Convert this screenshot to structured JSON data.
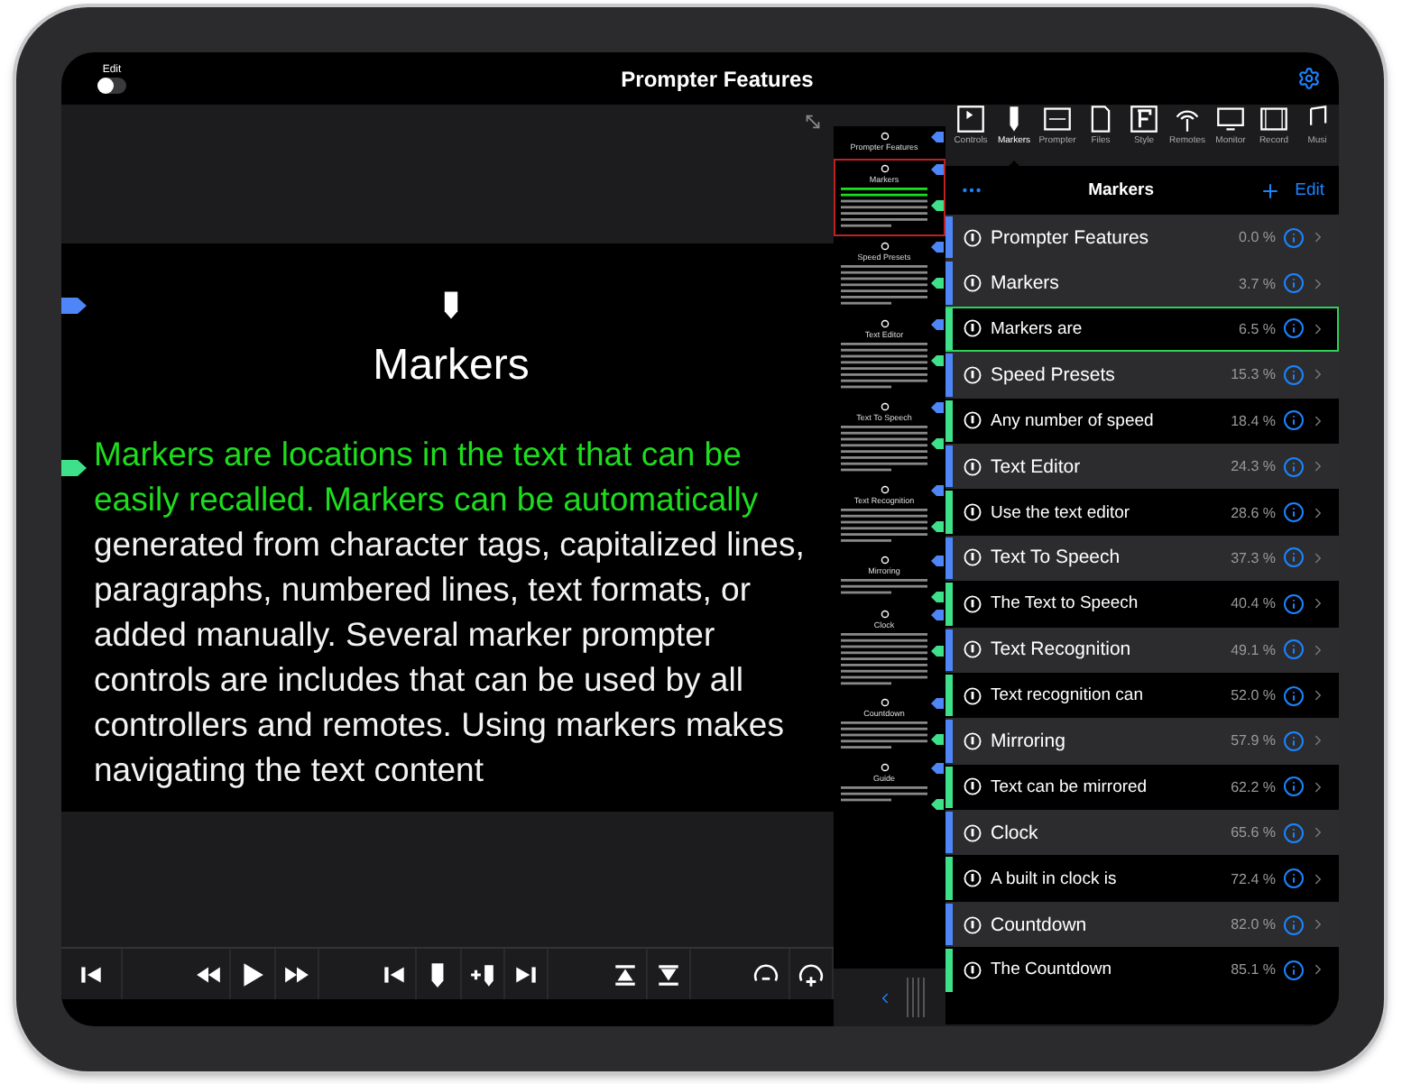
{
  "top_bar": {
    "edit_label": "Edit",
    "edit_on": false,
    "title": "Prompter Features"
  },
  "prompter": {
    "heading": "Markers",
    "segments": [
      {
        "text": "Markers are locations in the text that can be easily recalled. Markers can be automatically ",
        "current": true
      },
      {
        "text": "generated from character tags, capitalized lines, paragraphs, numbered lines, text formats, or added manually. Several marker prompter controls are includes that can be used by all controllers and remotes. Using markers makes navigating the text content",
        "current": false
      }
    ]
  },
  "thumbnails": [
    {
      "heading": "Prompter Features",
      "current": false
    },
    {
      "heading": "Markers",
      "current": true
    },
    {
      "heading": "Speed Presets",
      "current": false
    },
    {
      "heading": "Text Editor",
      "current": false
    },
    {
      "heading": "Text To Speech",
      "current": false
    },
    {
      "heading": "Text Recognition",
      "current": false
    },
    {
      "heading": "Mirroring",
      "current": false
    },
    {
      "heading": "Clock",
      "current": false
    },
    {
      "heading": "Countdown",
      "current": false
    },
    {
      "heading": "Guide",
      "current": false
    }
  ],
  "tabs": [
    {
      "label": "Controls",
      "selected": false
    },
    {
      "label": "Markers",
      "selected": true
    },
    {
      "label": "Prompter",
      "selected": false
    },
    {
      "label": "Files",
      "selected": false
    },
    {
      "label": "Style",
      "selected": false
    },
    {
      "label": "Remotes",
      "selected": false
    },
    {
      "label": "Monitor",
      "selected": false
    },
    {
      "label": "Record",
      "selected": false
    },
    {
      "label": "Musi",
      "selected": false
    }
  ],
  "list_header": {
    "title": "Markers",
    "edit": "Edit"
  },
  "markers": [
    {
      "title": "Prompter Features",
      "percent": "0.0 %",
      "kind": "heading",
      "selected": false
    },
    {
      "title": "Markers",
      "percent": "3.7 %",
      "kind": "heading",
      "selected": false
    },
    {
      "title": "Markers are",
      "percent": "6.5 %",
      "kind": "text",
      "selected": true
    },
    {
      "title": "Speed Presets",
      "percent": "15.3 %",
      "kind": "heading",
      "selected": false
    },
    {
      "title": "Any number of speed",
      "percent": "18.4 %",
      "kind": "text",
      "selected": false
    },
    {
      "title": "Text Editor",
      "percent": "24.3 %",
      "kind": "heading",
      "selected": false
    },
    {
      "title": "Use the text editor",
      "percent": "28.6 %",
      "kind": "text",
      "selected": false
    },
    {
      "title": "Text To Speech",
      "percent": "37.3 %",
      "kind": "heading",
      "selected": false
    },
    {
      "title": "The Text to Speech",
      "percent": "40.4 %",
      "kind": "text",
      "selected": false
    },
    {
      "title": "Text Recognition",
      "percent": "49.1 %",
      "kind": "heading",
      "selected": false
    },
    {
      "title": "Text recognition can",
      "percent": "52.0 %",
      "kind": "text",
      "selected": false
    },
    {
      "title": "Mirroring",
      "percent": "57.9 %",
      "kind": "heading",
      "selected": false
    },
    {
      "title": "Text can be mirrored",
      "percent": "62.2 %",
      "kind": "text",
      "selected": false
    },
    {
      "title": "Clock",
      "percent": "65.6 %",
      "kind": "heading",
      "selected": false
    },
    {
      "title": "A built in clock is",
      "percent": "72.4 %",
      "kind": "text",
      "selected": false
    },
    {
      "title": "Countdown",
      "percent": "82.0 %",
      "kind": "heading",
      "selected": false
    },
    {
      "title": "The Countdown",
      "percent": "85.1 %",
      "kind": "text",
      "selected": false
    }
  ]
}
